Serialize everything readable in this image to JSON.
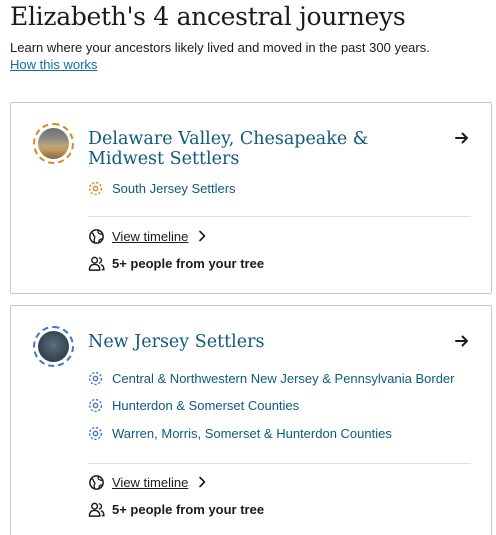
{
  "header": {
    "title": "Elizabeth's 4 ancestral journeys",
    "subtitle": "Learn where your ancestors likely lived and moved in the past 300 years.",
    "how_link": "How this works"
  },
  "cards": [
    {
      "title": "Delaware Valley, Chesapeake & Midwest Settlers",
      "accent_color": "#d4891d",
      "communities": [
        "South Jersey Settlers"
      ],
      "view_timeline": "View timeline",
      "people": "5+ people from your tree"
    },
    {
      "title": "New Jersey Settlers",
      "accent_color": "#3f74d6",
      "communities": [
        "Central & Northwestern New Jersey & Pennsylvania Border",
        "Hunterdon & Somerset Counties",
        "Warren, Morris, Somerset & Hunterdon Counties"
      ],
      "view_timeline": "View timeline",
      "people": "5+ people from your tree"
    }
  ]
}
